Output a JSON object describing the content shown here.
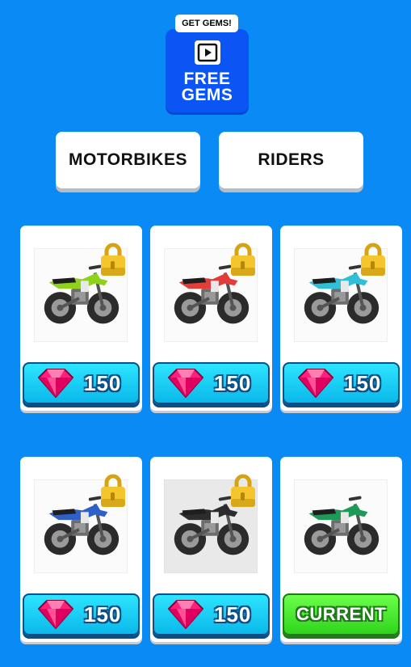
{
  "free_gems": {
    "tag": "GET GEMS!",
    "line1": "FREE",
    "line2": "GEMS"
  },
  "tabs": {
    "motorbikes": "MOTORBIKES",
    "riders": "RIDERS"
  },
  "bikes": [
    {
      "color": "#8ed21c",
      "locked": true,
      "button": "150",
      "dark_bg": false
    },
    {
      "color": "#e23d3a",
      "locked": true,
      "button": "150",
      "dark_bg": false
    },
    {
      "color": "#2fc0d8",
      "locked": true,
      "button": "150",
      "dark_bg": false
    },
    {
      "color": "#2f5fc8",
      "locked": true,
      "button": "150",
      "dark_bg": false
    },
    {
      "color": "#2c2c2c",
      "locked": true,
      "button": "150",
      "dark_bg": true
    },
    {
      "color": "#1e9a58",
      "locked": false,
      "button": "CURRENT",
      "dark_bg": false
    }
  ],
  "icons": {
    "gem": "gem-icon",
    "lock": "lock-icon",
    "play": "play-icon"
  },
  "colors": {
    "background": "#0a8af5",
    "free_gems_button": "#0a55f3",
    "price_button": "#1cd0f5",
    "current_button": "#46e030",
    "gem": "#ff1f7d"
  }
}
